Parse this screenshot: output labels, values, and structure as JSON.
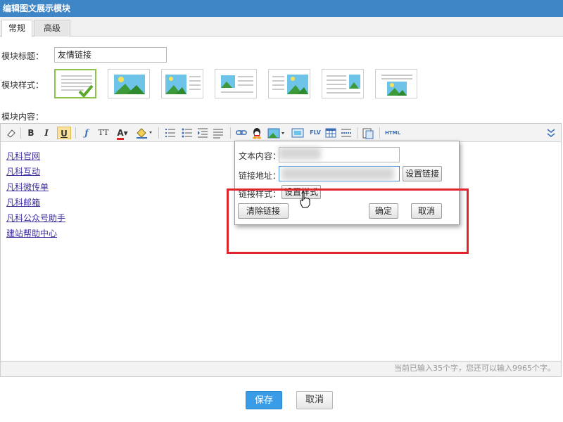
{
  "window": {
    "title": "编辑图文展示模块"
  },
  "tabs": [
    {
      "label": "常规"
    },
    {
      "label": "高级"
    }
  ],
  "form": {
    "title_label": "模块标题：",
    "title_value": "友情链接",
    "style_label": "模块样式：",
    "content_label": "模块内容："
  },
  "toolbar": {
    "bold": "B",
    "italic": "I",
    "underline": "U",
    "font_size": "TT",
    "font_color": "A",
    "html": "HTML",
    "flash": "FLV"
  },
  "content": {
    "links": [
      {
        "text": "凡科官网"
      },
      {
        "text": "凡科互动"
      },
      {
        "text": "凡科微传单"
      },
      {
        "text": "凡科邮箱"
      },
      {
        "text": "凡科公众号助手"
      },
      {
        "text": "建站帮助中心"
      }
    ]
  },
  "link_dialog": {
    "text_label": "文本内容：",
    "url_label": "链接地址：",
    "style_label": "链接样式：",
    "set_link_button": "设置链接",
    "set_style_button": "设置样式",
    "clear_link_button": "清除链接",
    "confirm_button": "确定",
    "cancel_button": "取消"
  },
  "status": {
    "counter": "当前已输入35个字，您还可以输入9965个字。"
  },
  "footer": {
    "save_button": "保存",
    "cancel_button": "取消"
  },
  "colors": {
    "title_bar": "#3f86c7",
    "save_button": "#3a9ce6",
    "highlight_box": "#e0262c",
    "link": "#3b2fa0",
    "selected_style": "#8ec34b"
  }
}
